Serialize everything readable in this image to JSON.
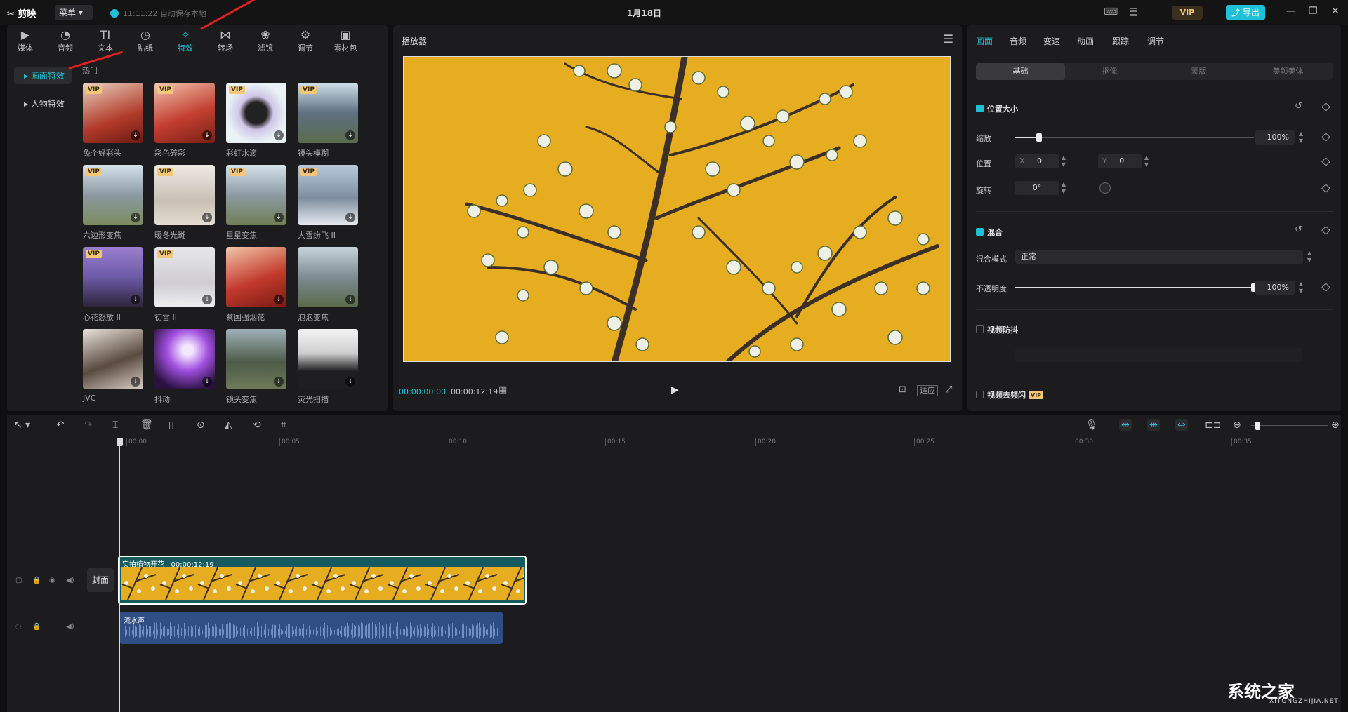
{
  "app": {
    "logo": "✂ 剪映",
    "menu_label": "菜单",
    "autosave": "11:11:22 自动保存本地",
    "date": "1月18日",
    "vip": "VIP",
    "export_label": "⤴ 导出"
  },
  "colors": {
    "accent": "#20c1d6",
    "vip": "#f2c77a",
    "video_bg": "#e5ad1f",
    "audio_clip": "#2f4e84",
    "video_clip": "#135b5f"
  },
  "top_tabs": [
    {
      "label": "媒体",
      "icon": "media-icon"
    },
    {
      "label": "音频",
      "icon": "audio-icon"
    },
    {
      "label": "文本",
      "icon": "text-icon"
    },
    {
      "label": "贴纸",
      "icon": "sticker-icon"
    },
    {
      "label": "特效",
      "icon": "effects-icon"
    },
    {
      "label": "转场",
      "icon": "transition-icon"
    },
    {
      "label": "滤镜",
      "icon": "filter-icon"
    },
    {
      "label": "调节",
      "icon": "adjust-icon"
    },
    {
      "label": "素材包",
      "icon": "package-icon"
    }
  ],
  "sidebar": {
    "items": [
      {
        "label": "画面特效"
      },
      {
        "label": "人物特效"
      }
    ]
  },
  "section_label": "热门",
  "effects": [
    {
      "name": "兔个好彩头",
      "vip": "VIP"
    },
    {
      "name": "彩色碎彩",
      "vip": "VIP"
    },
    {
      "name": "彩虹水滴",
      "vip": "VIP"
    },
    {
      "name": "镜头模糊",
      "vip": "VIP"
    },
    {
      "name": "六边形变焦",
      "vip": "VIP"
    },
    {
      "name": "暖冬光斑",
      "vip": "VIP"
    },
    {
      "name": "星星变焦",
      "vip": "VIP"
    },
    {
      "name": "大雪纷飞 II",
      "vip": "VIP"
    },
    {
      "name": "心花怒放 II",
      "vip": "VIP"
    },
    {
      "name": "初雪 II",
      "vip": "VIP"
    },
    {
      "name": "蔡国强烟花",
      "vip": ""
    },
    {
      "name": "泡泡变焦",
      "vip": ""
    },
    {
      "name": "JVC",
      "vip": ""
    },
    {
      "name": "抖动",
      "vip": ""
    },
    {
      "name": "镜头变焦",
      "vip": ""
    },
    {
      "name": "荧光扫描",
      "vip": ""
    }
  ],
  "player": {
    "title": "播放器",
    "current_time": "00:00:00:00",
    "total_time": "00:00:12:19",
    "fit_label": "适应"
  },
  "props": {
    "tabs": [
      "画面",
      "音频",
      "变速",
      "动画",
      "跟踪",
      "调节"
    ],
    "subtabs": [
      "基础",
      "抠像",
      "蒙版",
      "美颜美体"
    ],
    "position_size_label": "位置大小",
    "scale_label": "缩放",
    "scale_value": "100%",
    "scale_level": 0.1,
    "position_label": "位置",
    "x_label": "X",
    "x_value": "0",
    "y_label": "Y",
    "y_value": "0",
    "rotate_label": "旋转",
    "rotate_value": "0°",
    "blend_label": "混合",
    "blend_mode_label": "混合模式",
    "blend_mode_value": "正常",
    "opacity_label": "不透明度",
    "opacity_value": "100%",
    "opacity_level": 1.0,
    "stabilize_label": "视频防抖",
    "deflicker_label": "视频去频闪",
    "deflicker_vip": "VIP"
  },
  "timeline": {
    "ruler": [
      "00:00",
      "00:05",
      "00:10",
      "00:15",
      "00:20",
      "00:25",
      "00:30",
      "00:35"
    ],
    "cover_label": "封面",
    "video_clip": {
      "name": "实拍植物开花",
      "duration": "00:00:12:19"
    },
    "audio_clip": {
      "name": "流水声"
    }
  },
  "watermark": {
    "text": "系统之家",
    "url": "XITONGZHIJIA.NET"
  }
}
